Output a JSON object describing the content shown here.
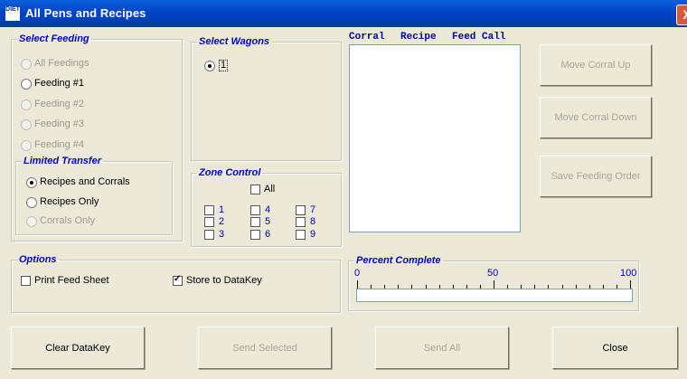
{
  "window": {
    "title": "All Pens and Recipes",
    "app_icon": "DIET",
    "close_glyph": "X"
  },
  "select_feeding": {
    "legend": "Select Feeding",
    "options": [
      {
        "label": "All Feedings",
        "selected": false,
        "enabled": false
      },
      {
        "label": "Feeding #1",
        "selected": false,
        "enabled": true
      },
      {
        "label": "Feeding #2",
        "selected": false,
        "enabled": false
      },
      {
        "label": "Feeding #3",
        "selected": false,
        "enabled": false
      },
      {
        "label": "Feeding #4",
        "selected": false,
        "enabled": false
      }
    ]
  },
  "limited_transfer": {
    "legend": "Limited Transfer",
    "options": [
      {
        "label": "Recipes and Corrals",
        "selected": true,
        "enabled": true
      },
      {
        "label": "Recipes Only",
        "selected": false,
        "enabled": true
      },
      {
        "label": "Corrals  Only",
        "selected": false,
        "enabled": false
      }
    ]
  },
  "select_wagons": {
    "legend": "Select Wagons",
    "options": [
      {
        "label": "1",
        "selected": true
      }
    ]
  },
  "zone_control": {
    "legend": "Zone Control",
    "all_label": "All",
    "zones": [
      "1",
      "2",
      "3",
      "4",
      "5",
      "6",
      "7",
      "8",
      "9"
    ]
  },
  "list": {
    "columns": [
      "Corral",
      "Recipe",
      "Feed Call"
    ],
    "rows": []
  },
  "right_buttons": {
    "move_up": "Move Corral Up",
    "move_down": "Move Corral Down",
    "save_order": "Save Feeding Order"
  },
  "options": {
    "legend": "Options",
    "print_feed_sheet": "Print Feed Sheet",
    "print_checked": false,
    "store_datakey": "Store to DataKey",
    "store_checked": true
  },
  "percent_complete": {
    "legend": "Percent Complete",
    "min_label": "0",
    "mid_label": "50",
    "max_label": "100",
    "value": 0
  },
  "bottom_buttons": {
    "clear": "Clear DataKey",
    "send_selected": "Send Selected",
    "send_all": "Send All",
    "close": "Close"
  },
  "colors": {
    "accent_blue": "#0000cc",
    "titlebar": "#0044c8",
    "face": "#ece9d8"
  }
}
